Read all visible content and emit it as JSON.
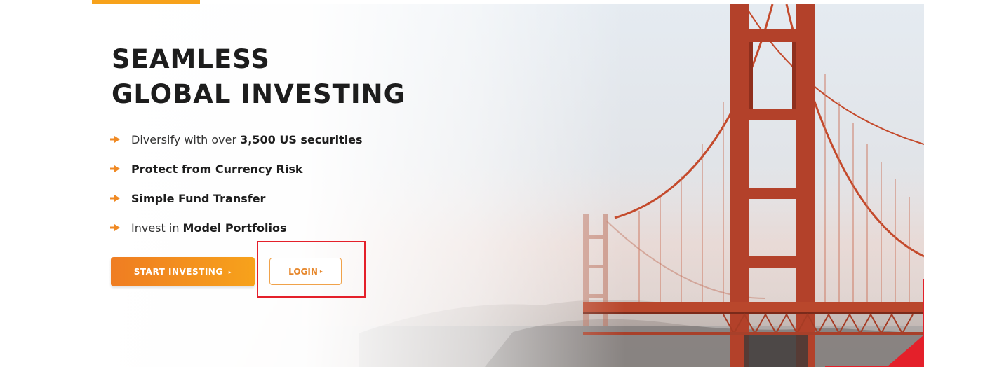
{
  "hero": {
    "title_lines": [
      "SEAMLESS",
      "GLOBAL INVESTING"
    ],
    "features": [
      {
        "pre": "Diversify with over",
        "bold": "3,500 US securities",
        "post": ""
      },
      {
        "pre": "",
        "bold": "Protect from Currency Risk",
        "post": ""
      },
      {
        "pre": "",
        "bold": "Simple Fund Transfer",
        "post": ""
      },
      {
        "pre": "Invest in",
        "bold": "Model Portfolios",
        "post": ""
      }
    ],
    "start_button": {
      "label": "START INVESTING",
      "chevron": "▸"
    },
    "login_button": {
      "label": "LOGIN",
      "chevron": "▸"
    }
  },
  "colors": {
    "accent_orange": "#f7a21b",
    "accent_orange_dark": "#ef7d22",
    "highlight_red": "#e4202a",
    "title_text": "#1d1d1d",
    "bridge_red": "#c84a2c"
  },
  "icons": {
    "feature_bullet": "orange-arrow-icon",
    "hero_image": "golden-gate-bridge-image"
  }
}
